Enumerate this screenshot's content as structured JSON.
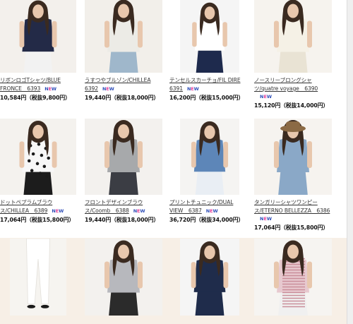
{
  "products": [
    {
      "name_lines": [
        "リボンロゴTシャツ/BLUE",
        "FRONCE　6393"
      ],
      "badge_inline_line": 1,
      "badge": "NEW",
      "price": "10,584円（税抜9,800円）",
      "top_color": "#232a47",
      "bottom_color": "#f2f2f2",
      "bg": "#f3f0ec",
      "has_hat": false
    },
    {
      "name_lines": [
        "うすつやブルゾン/CHILLEA",
        "6392"
      ],
      "badge_inline_line": 1,
      "badge": "NEW",
      "price": "19,440円（税抜18,000円）",
      "top_color": "#ecebe6",
      "bottom_color": "#9fb7cb",
      "bg": "#f2efea",
      "has_hat": false
    },
    {
      "name_lines": [
        "テンセルスカーチョ/FIL DIRE",
        "6391"
      ],
      "badge_inline_line": 1,
      "badge": "NEW",
      "price": "16,200円（税抜15,000円）",
      "top_color": "#ffffff",
      "bottom_color": "#1e2a4d",
      "bg": "#f5f5f5",
      "has_hat": false
    },
    {
      "name_lines": [
        "ノースリーブロングシャ",
        "ツ/quatre voyage　6390"
      ],
      "badge_inline_line": 2,
      "badge": "NEW",
      "price": "15,120円（税抜14,000円）",
      "top_color": "#f5f1e6",
      "bottom_color": "#e9e3d4",
      "bg": "#f6f3ee",
      "has_hat": false
    },
    {
      "name_lines": [
        "ドットペプラムブラウ",
        "ス/CHILLEA　6389"
      ],
      "badge_inline_line": 1,
      "badge": "NEW",
      "price": "17,064円（税抜15,800円）",
      "top_color": "#f7f7f7",
      "bottom_color": "#1c1c1c",
      "bg": "#f4f2ee",
      "has_hat": false
    },
    {
      "name_lines": [
        "フロントデザインブラウ",
        "ス/Coomb　6388"
      ],
      "badge_inline_line": 1,
      "badge": "NEW",
      "price": "19,440円（税抜18,000円）",
      "top_color": "#a7a9ab",
      "bottom_color": "#3b3d44",
      "bg": "#f3f1ee",
      "has_hat": false
    },
    {
      "name_lines": [
        "プリントチュニック/DUAL",
        "VIEW　6387"
      ],
      "badge_inline_line": 1,
      "badge": "NEW",
      "price": "36,720円（税抜34,000円）",
      "top_color": "#5d86b8",
      "bottom_color": "#e9eef4",
      "bg": "#f5f4f2",
      "has_hat": false
    },
    {
      "name_lines": [
        "タンガリーシャツワンピー",
        "ス/ETERNO BELLEZZA　6386"
      ],
      "badge_inline_line": 2,
      "badge": "NEW",
      "price": "17,064円（税抜15,800円）",
      "top_color": "#8aa8c7",
      "bottom_color": "#8aa8c7",
      "bg": "#f6f3ef",
      "has_hat": true
    },
    {
      "name_lines": [],
      "badge": "",
      "price": "",
      "top_color": "#f4f2ee",
      "bottom_color": "#ffffff",
      "bg": "#f6f4f0",
      "has_hat": false
    },
    {
      "name_lines": [],
      "badge": "",
      "price": "",
      "top_color": "#b7b8bd",
      "bottom_color": "#2b2b2b",
      "bg": "#f3f1ee",
      "has_hat": false
    },
    {
      "name_lines": [],
      "badge": "",
      "price": "",
      "top_color": "#1f2c4b",
      "bottom_color": "#1f2c4b",
      "bg": "#f5f5f5",
      "has_hat": false
    },
    {
      "name_lines": [],
      "badge": "",
      "price": "",
      "top_color": "#e7c9cf",
      "bottom_color": "#f0f0f0",
      "bg": "#f6f4f1",
      "has_hat": false
    }
  ]
}
